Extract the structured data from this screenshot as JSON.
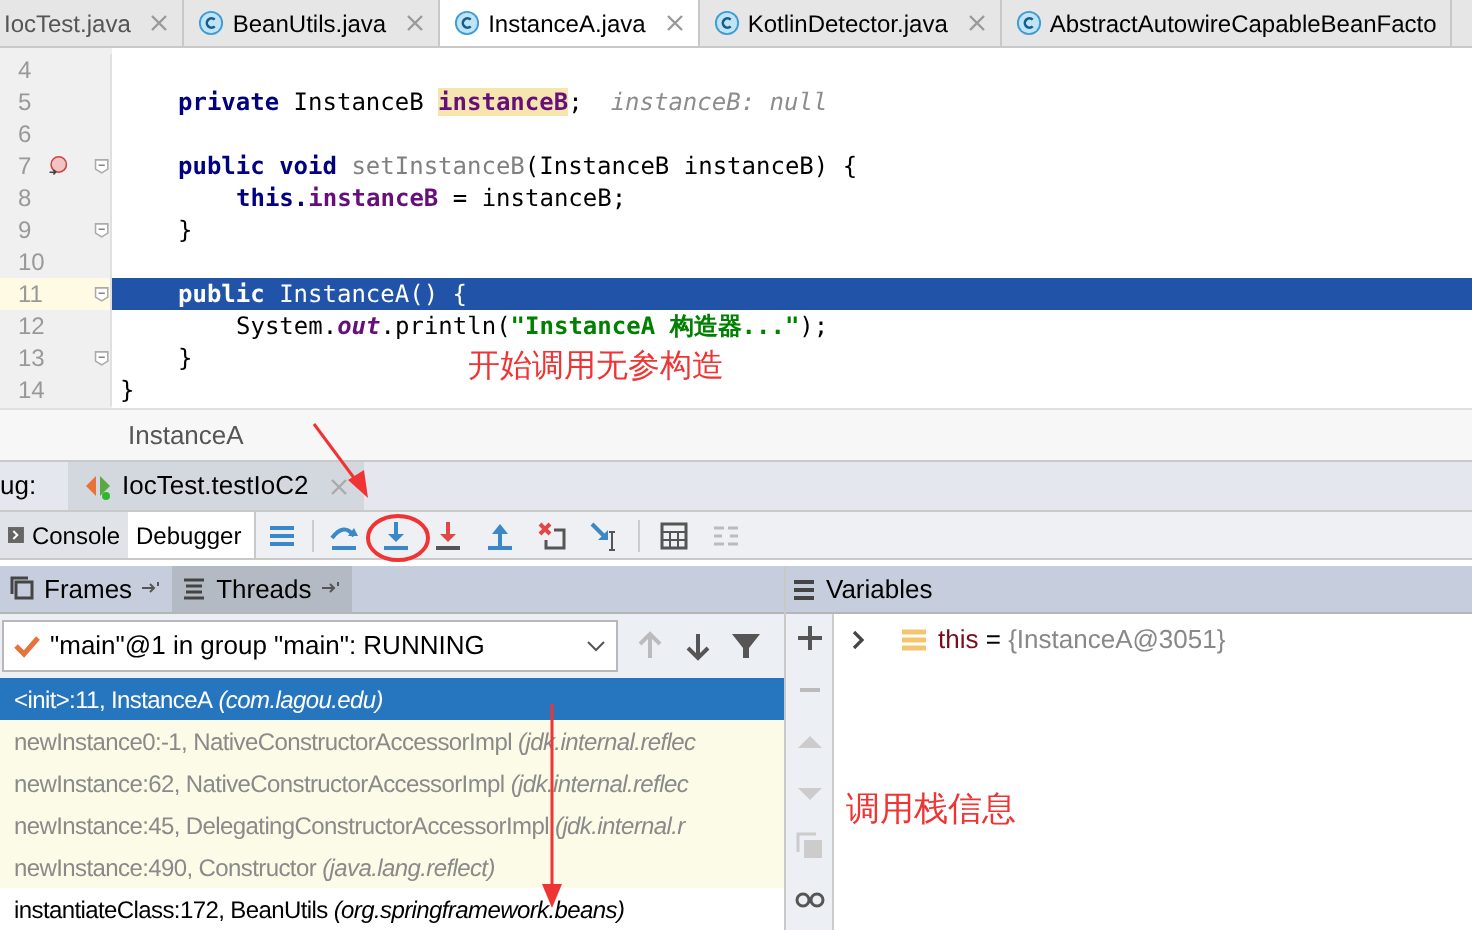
{
  "editor_tabs": [
    {
      "label": "IocTest.java",
      "selected": false,
      "icon": false,
      "closable": true
    },
    {
      "label": "BeanUtils.java",
      "selected": false,
      "icon": true,
      "closable": true
    },
    {
      "label": "InstanceA.java",
      "selected": true,
      "icon": true,
      "closable": true
    },
    {
      "label": "KotlinDetector.java",
      "selected": false,
      "icon": true,
      "closable": true
    },
    {
      "label": "AbstractAutowireCapableBeanFacto",
      "selected": false,
      "icon": true,
      "closable": false
    }
  ],
  "code_lines": [
    {
      "number": "4",
      "current": false,
      "fold": false,
      "override": false
    },
    {
      "number": "5",
      "current": false,
      "fold": false,
      "override": false,
      "kind": "member",
      "tokens": [
        {
          "kind": "keyword",
          "text": "private "
        },
        {
          "kind": "plain",
          "text": "InstanceB "
        },
        {
          "kind": "usage",
          "text": "instanceB"
        },
        {
          "kind": "plain",
          "text": ";"
        },
        {
          "kind": "hint",
          "text": "instanceB: null"
        }
      ]
    },
    {
      "number": "6",
      "current": false,
      "fold": false,
      "override": false
    },
    {
      "number": "7",
      "current": false,
      "fold": true,
      "override": true,
      "kind": "member",
      "tokens": [
        {
          "kind": "keyword",
          "text": "public void "
        },
        {
          "kind": "unused",
          "text": "setInstanceB"
        },
        {
          "kind": "plain",
          "text": "(InstanceB instanceB) {"
        }
      ]
    },
    {
      "number": "8",
      "current": false,
      "fold": false,
      "override": false,
      "kind": "body",
      "tokens": [
        {
          "kind": "keyword",
          "text": "this."
        },
        {
          "kind": "field",
          "text": "instanceB"
        },
        {
          "kind": "plain",
          "text": " = instanceB;"
        }
      ]
    },
    {
      "number": "9",
      "current": false,
      "fold": true,
      "override": false,
      "kind": "member",
      "tokens": [
        {
          "kind": "plain",
          "text": "}"
        }
      ]
    },
    {
      "number": "10",
      "current": false,
      "fold": false,
      "override": false
    },
    {
      "number": "11",
      "current": true,
      "fold": true,
      "override": false,
      "kind": "member",
      "tokens": [
        {
          "kind": "keyword",
          "text": "public "
        },
        {
          "kind": "plain",
          "text": "InstanceA() {"
        }
      ]
    },
    {
      "number": "12",
      "current": false,
      "fold": false,
      "override": false,
      "kind": "body",
      "tokens": [
        {
          "kind": "plain",
          "text": "System."
        },
        {
          "kind": "static",
          "text": "out"
        },
        {
          "kind": "plain",
          "text": ".println("
        },
        {
          "kind": "string",
          "text": "\"InstanceA 构造器...\""
        },
        {
          "kind": "plain",
          "text": ");"
        }
      ]
    },
    {
      "number": "13",
      "current": false,
      "fold": true,
      "override": false,
      "kind": "member",
      "tokens": [
        {
          "kind": "plain",
          "text": "}"
        }
      ]
    },
    {
      "number": "14",
      "current": false,
      "fold": false,
      "override": false,
      "kind": "top",
      "tokens": [
        {
          "kind": "plain",
          "text": "}"
        }
      ]
    }
  ],
  "annotations": [
    "开始调用无参构造",
    "调用栈信息"
  ],
  "breadcrumb": "InstanceA",
  "debug_bar": {
    "label": "ug:",
    "session_tab": "IocTest.testIoC2"
  },
  "debug_tabs": [
    {
      "label": "Console",
      "selected": false
    },
    {
      "label": "Debugger",
      "selected": true
    }
  ],
  "frames_panel": {
    "tabs": [
      {
        "label": "Frames",
        "selected": true
      },
      {
        "label": "Threads",
        "selected": false
      }
    ],
    "thread": "\"main\"@1 in group \"main\": RUNNING",
    "frames": [
      {
        "method": "<init>:11, InstanceA",
        "package": "(com.lagou.edu)",
        "selected": true,
        "library": false
      },
      {
        "method": "newInstance0:-1, NativeConstructorAccessorImpl",
        "package": "(jdk.internal.reflec",
        "selected": false,
        "library": true
      },
      {
        "method": "newInstance:62, NativeConstructorAccessorImpl",
        "package": "(jdk.internal.reflec",
        "selected": false,
        "library": true
      },
      {
        "method": "newInstance:45, DelegatingConstructorAccessorImpl",
        "package": "(jdk.internal.r",
        "selected": false,
        "library": true
      },
      {
        "method": "newInstance:490, Constructor",
        "package": "(java.lang.reflect)",
        "selected": false,
        "library": true
      },
      {
        "method": "instantiateClass:172, BeanUtils",
        "package": "(org.springframework.beans)",
        "selected": false,
        "library": false
      }
    ]
  },
  "variables_panel": {
    "title": "Variables",
    "variables": [
      {
        "name": "this",
        "operator": "=",
        "value": "{InstanceA@3051}"
      }
    ]
  }
}
